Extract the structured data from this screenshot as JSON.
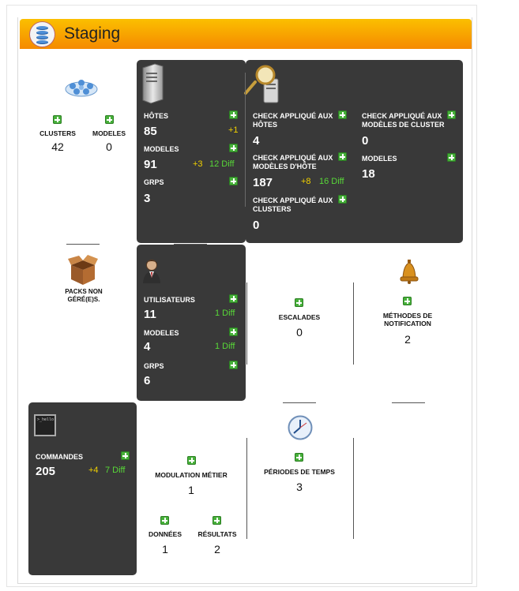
{
  "header": {
    "title": "Staging",
    "icon": "database-icon"
  },
  "clusters_block": {
    "clusters": {
      "label": "CLUSTERS",
      "value": "42"
    },
    "modeles": {
      "label": "MODELES",
      "value": "0"
    }
  },
  "hosts_card": {
    "hotes": {
      "label": "HÔTES",
      "value": "85",
      "delta": "+1"
    },
    "modeles": {
      "label": "MODELES",
      "value": "91",
      "delta": "+3",
      "diff": "12 Diff"
    },
    "grps": {
      "label": "GRPS",
      "value": "3"
    }
  },
  "checks_card": {
    "hotes": {
      "label": "CHECK APPLIQUÉ AUX HÔTES",
      "value": "4"
    },
    "modeles_hote": {
      "label": "CHECK APPLIQUÉ AUX MODÈLES D'HÔTE",
      "value": "187",
      "delta": "+8",
      "diff": "16 Diff"
    },
    "clusters": {
      "label": "CHECK APPLIQUÉ AUX CLUSTERS",
      "value": "0"
    },
    "modeles_cluster": {
      "label": "CHECK APPLIQUÉ AUX MODÈLES DE CLUSTER",
      "value": "0"
    },
    "modeles": {
      "label": "MODELES",
      "value": "18"
    }
  },
  "packs": {
    "label": "PACKS NON GÉRÉ(E)S."
  },
  "users_card": {
    "utilisateurs": {
      "label": "UTILISATEURS",
      "value": "11",
      "diff": "1 Diff"
    },
    "modeles": {
      "label": "MODELES",
      "value": "4",
      "diff": "1 Diff"
    },
    "grps": {
      "label": "GRPS",
      "value": "6"
    }
  },
  "escalades": {
    "label": "ESCALADES",
    "value": "0"
  },
  "methodes": {
    "label": "MÉTHODES DE NOTIFICATION",
    "value": "2"
  },
  "commands_card": {
    "terminal_text": ">_hello",
    "commandes": {
      "label": "COMMANDES",
      "value": "205",
      "delta": "+4",
      "diff": "7 Diff"
    }
  },
  "modulation": {
    "metier": {
      "label": "MODULATION MÉTIER",
      "value": "1"
    },
    "donnees": {
      "label": "DONNÉES",
      "value": "1"
    },
    "resultats": {
      "label": "RÉSULTATS",
      "value": "2"
    }
  },
  "periodes": {
    "label": "PÉRIODES DE TEMPS",
    "value": "3"
  }
}
